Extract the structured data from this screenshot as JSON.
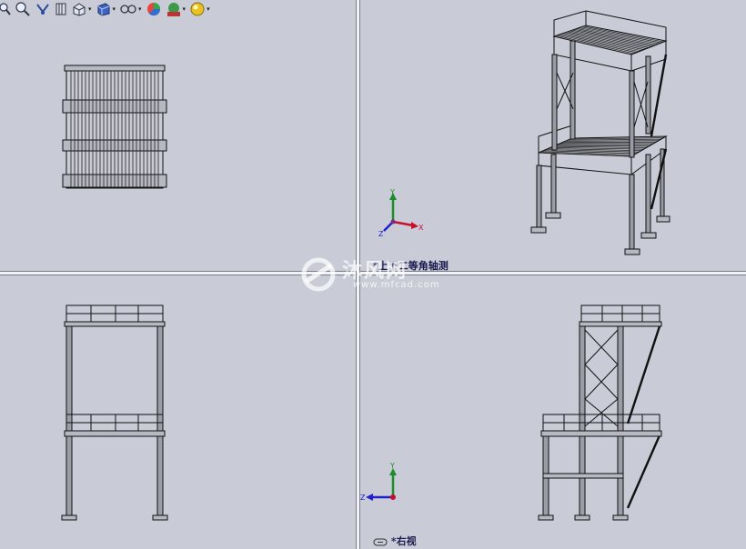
{
  "toolbar": {
    "tools": [
      {
        "name": "zoom-to-fit-icon"
      },
      {
        "name": "zoom-to-area-icon"
      },
      {
        "name": "previous-view-icon"
      },
      {
        "name": "section-view-icon"
      },
      {
        "name": "view-orientation-icon"
      },
      {
        "name": "display-style-icon"
      },
      {
        "name": "hide-show-items-icon"
      },
      {
        "name": "edit-appearance-icon"
      },
      {
        "name": "apply-scene-icon"
      },
      {
        "name": "view-settings-icon"
      }
    ]
  },
  "views": {
    "isometric_label": "*上下二等角轴测",
    "right_label": "*右视"
  },
  "triad": {
    "x_label": "X",
    "y_label": "Y",
    "z_label": "Z",
    "x_color": "#c8102e",
    "y_color": "#1a8c2a",
    "z_color": "#2020c8"
  },
  "watermark": {
    "text": "沐风网",
    "url": "www.mfcad.com"
  }
}
